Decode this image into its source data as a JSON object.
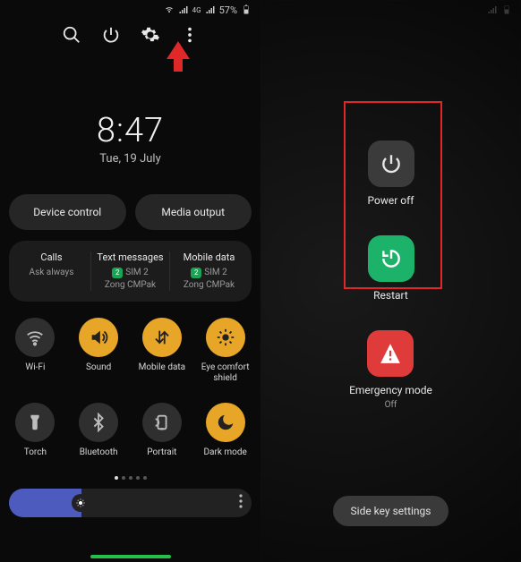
{
  "status_bar": {
    "battery_pct": "57%"
  },
  "top_icons": {
    "search": "search-icon",
    "power": "power-icon",
    "settings": "gear-icon",
    "more": "more-icon"
  },
  "clock": {
    "time": "8:47",
    "date": "Tue, 19 July"
  },
  "pills": {
    "device_control": "Device control",
    "media_output": "Media output"
  },
  "sim_card": {
    "calls": {
      "title": "Calls",
      "sub": "Ask always"
    },
    "texts": {
      "title": "Text messages",
      "badge": "2",
      "sim": "SIM 2",
      "carrier": "Zong CMPak"
    },
    "data": {
      "title": "Mobile data",
      "badge": "2",
      "sim": "SIM 2",
      "carrier": "Zong CMPak"
    }
  },
  "qs": [
    {
      "name": "wifi-tile",
      "label": "Wi-Fi",
      "on": false
    },
    {
      "name": "sound-tile",
      "label": "Sound",
      "on": true
    },
    {
      "name": "mobile-data-tile",
      "label": "Mobile data",
      "on": true
    },
    {
      "name": "eye-comfort-tile",
      "label": "Eye comfort shield",
      "on": true
    },
    {
      "name": "torch-tile",
      "label": "Torch",
      "on": false
    },
    {
      "name": "bluetooth-tile",
      "label": "Bluetooth",
      "on": false
    },
    {
      "name": "portrait-tile",
      "label": "Portrait",
      "on": false
    },
    {
      "name": "dark-mode-tile",
      "label": "Dark mode",
      "on": true
    }
  ],
  "power_menu": {
    "power_off": "Power off",
    "restart": "Restart",
    "emergency_label": "Emergency mode",
    "emergency_state": "Off",
    "side_key": "Side key settings"
  }
}
